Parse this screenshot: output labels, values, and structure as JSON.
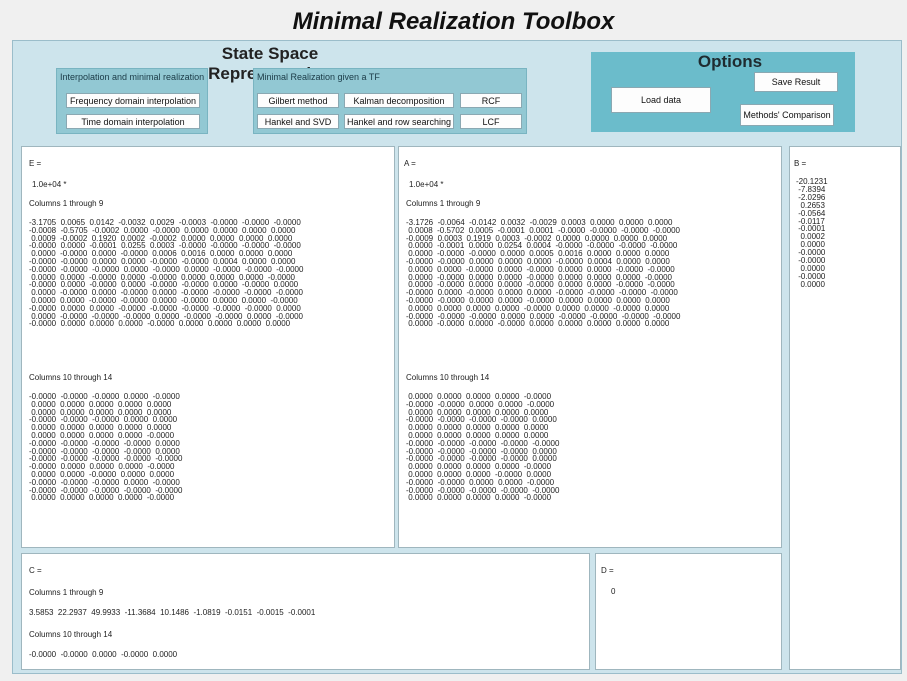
{
  "app": {
    "title": "Minimal Realization Toolbox"
  },
  "state_space": {
    "title": "State Space Representation",
    "interp_label": "Interpolation and minimal realization",
    "tf_label": "Minimal Realization given a TF",
    "buttons": {
      "freq": "Frequency domain interpolation",
      "time": "Time domain interpolation",
      "gilbert": "Gilbert method",
      "kalman": "Kalman decomposition",
      "rcf": "RCF",
      "hankel_svd": "Hankel and SVD",
      "hankel_row": "Hankel and row searching",
      "lcf": "LCF"
    }
  },
  "options": {
    "title": "Options",
    "load": "Load data",
    "save": "Save Result",
    "compare": "Methods' Comparison"
  },
  "E": {
    "label": "E =",
    "scale": "1.0e+04 *",
    "cols1": "Columns 1 through 9",
    "cols2": "Columns 10 through 14",
    "block1": "-3.1705  0.0065  0.0142  -0.0032  0.0029  -0.0003  -0.0000  -0.0000  -0.0000\n-0.0008  -0.5705  -0.0002  0.0000  -0.0000  0.0000  0.0000  0.0000  0.0000\n 0.0009  -0.0002  0.1920  0.0002  -0.0002  0.0000  0.0000  0.0000  0.0000\n-0.0000  0.0000  -0.0001  0.0255  0.0003  -0.0000  -0.0000  -0.0000  -0.0000\n 0.0000  -0.0000  0.0000  -0.0000  0.0006  0.0016  0.0000  0.0000  0.0000\n-0.0000  -0.0000  0.0000  0.0000  -0.0000  -0.0000  0.0004  0.0000  0.0000\n-0.0000  -0.0000  -0.0000  0.0000  -0.0000  0.0000  -0.0000  -0.0000  -0.0000\n 0.0000  0.0000  -0.0000  0.0000  -0.0000  0.0000  0.0000  0.0000  -0.0000\n-0.0000  0.0000  -0.0000  0.0000  -0.0000  -0.0000  0.0000  -0.0000  0.0000\n 0.0000  -0.0000  0.0000  -0.0000  0.0000  -0.0000  -0.0000  -0.0000  -0.0000\n 0.0000  0.0000  -0.0000  -0.0000  0.0000  -0.0000  0.0000  0.0000  -0.0000\n-0.0000  0.0000  0.0000  -0.0000  -0.0000  -0.0000  -0.0000  -0.0000  0.0000\n 0.0000  -0.0000  -0.0000  -0.0000  0.0000  -0.0000  -0.0000  0.0000  -0.0000\n-0.0000  0.0000  0.0000  0.0000  -0.0000  0.0000  0.0000  0.0000  0.0000",
    "block2": "-0.0000  -0.0000  -0.0000  0.0000  -0.0000\n 0.0000  0.0000  0.0000  0.0000  0.0000\n 0.0000  0.0000  0.0000  0.0000  0.0000\n-0.0000  -0.0000  -0.0000  0.0000  0.0000\n 0.0000  0.0000  0.0000  0.0000  0.0000\n 0.0000  0.0000  0.0000  0.0000  -0.0000\n-0.0000  -0.0000  -0.0000  -0.0000  0.0000\n-0.0000  -0.0000  -0.0000  -0.0000  0.0000\n-0.0000  -0.0000  -0.0000  -0.0000  -0.0000\n-0.0000  0.0000  0.0000  0.0000  -0.0000\n 0.0000  0.0000  -0.0000  0.0000  0.0000\n-0.0000  -0.0000  -0.0000  0.0000  -0.0000\n-0.0000  -0.0000  -0.0000  -0.0000  -0.0000\n 0.0000  0.0000  0.0000  0.0000  -0.0000"
  },
  "A": {
    "label": "A =",
    "scale": "1.0e+04 *",
    "cols1": "Columns 1 through 9",
    "cols2": "Columns 10 through 14",
    "block1": "-3.1726  -0.0064  -0.0142  0.0032  -0.0029  0.0003  0.0000  0.0000  0.0000\n 0.0008  -0.5702  0.0005  -0.0001  0.0001  -0.0000  -0.0000  -0.0000  -0.0000\n-0.0009  0.0003  0.1919  0.0003  -0.0002  0.0000  0.0000  0.0000  0.0000\n 0.0000  -0.0001  0.0000  0.0254  0.0004  -0.0000  -0.0000  -0.0000  -0.0000\n 0.0000  -0.0000  -0.0000  0.0000  0.0005  0.0016  0.0000  0.0000  0.0000\n-0.0000  -0.0000  0.0000  0.0000  0.0000  -0.0000  0.0004  0.0000  0.0000\n 0.0000  0.0000  -0.0000  0.0000  -0.0000  0.0000  0.0000  -0.0000  -0.0000\n 0.0000  -0.0000  0.0000  0.0000  -0.0000  0.0000  0.0000  0.0000  -0.0000\n 0.0000  -0.0000  0.0000  0.0000  -0.0000  0.0000  0.0000  -0.0000  -0.0000\n-0.0000  0.0000  -0.0000  0.0000  0.0000  -0.0000  -0.0000  -0.0000  -0.0000\n-0.0000  -0.0000  0.0000  0.0000  -0.0000  0.0000  0.0000  0.0000  0.0000\n 0.0000  0.0000  0.0000  0.0000  -0.0000  0.0000  0.0000  -0.0000  0.0000\n-0.0000  -0.0000  -0.0000  0.0000  0.0000  -0.0000  -0.0000  -0.0000  -0.0000\n 0.0000  -0.0000  0.0000  -0.0000  0.0000  0.0000  0.0000  0.0000  0.0000",
    "block2": " 0.0000  0.0000  0.0000  0.0000  -0.0000\n-0.0000  -0.0000  0.0000  0.0000  -0.0000\n 0.0000  0.0000  0.0000  0.0000  0.0000\n-0.0000  -0.0000  -0.0000  -0.0000  0.0000\n 0.0000  0.0000  0.0000  0.0000  0.0000\n 0.0000  0.0000  0.0000  0.0000  0.0000\n-0.0000  -0.0000  -0.0000  -0.0000  -0.0000\n-0.0000  -0.0000  -0.0000  -0.0000  0.0000\n-0.0000  -0.0000  -0.0000  -0.0000  0.0000\n 0.0000  0.0000  0.0000  0.0000  -0.0000\n 0.0000  0.0000  0.0000  -0.0000  0.0000\n-0.0000  -0.0000  0.0000  0.0000  -0.0000\n-0.0000  -0.0000  -0.0000  -0.0000  -0.0000\n 0.0000  0.0000  0.0000  0.0000  -0.0000"
  },
  "B": {
    "label": "B =",
    "values": "-20.1231\n -7.8394\n -2.0296\n  0.2653\n -0.0564\n -0.0117\n -0.0001\n  0.0002\n  0.0000\n -0.0000\n -0.0000\n  0.0000\n -0.0000\n  0.0000"
  },
  "C": {
    "label": "C =",
    "cols1": "Columns 1 through 9",
    "row1": "3.5853  22.2937  49.9933  -11.3684  10.1486  -1.0819  -0.0151  -0.0015  -0.0001",
    "cols2": "Columns 10 through 14",
    "row2": "-0.0000  -0.0000  0.0000  -0.0000  0.0000"
  },
  "D": {
    "label": "D =",
    "value": "0"
  }
}
